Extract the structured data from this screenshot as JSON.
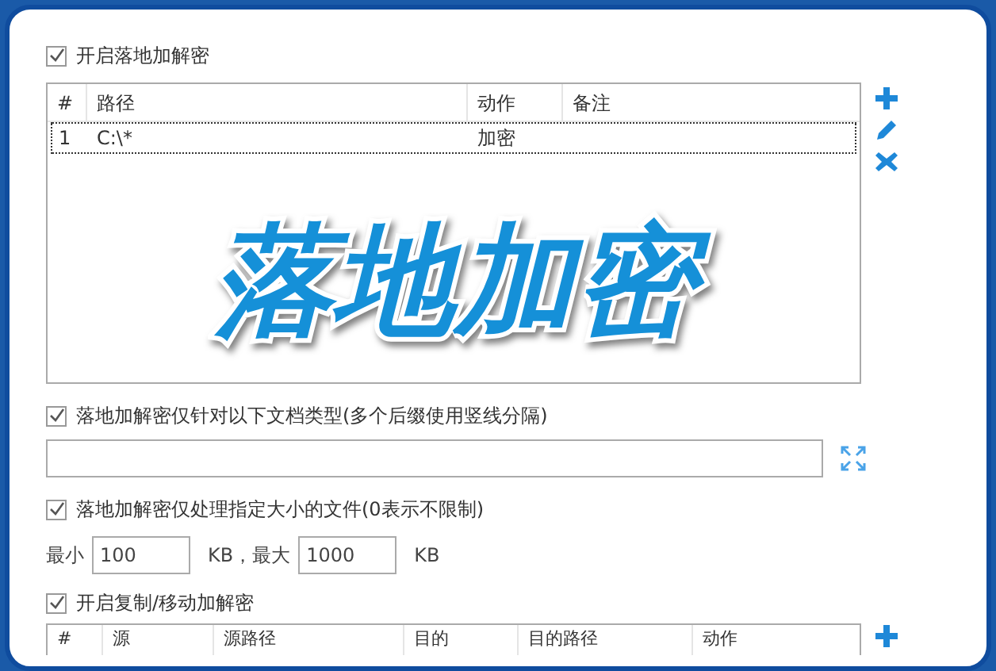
{
  "enable_section": {
    "label": "开启落地加解密",
    "checked": true
  },
  "rules_table": {
    "columns": [
      "#",
      "路径",
      "动作",
      "备注"
    ],
    "rows": [
      {
        "cells": [
          "1",
          "C:\\*",
          "加密",
          ""
        ],
        "selected": true
      }
    ]
  },
  "overlay_title": "落地加密",
  "doc_types": {
    "label": "落地加解密仅针对以下文档类型(多个后缀使用竖线分隔)",
    "checked": true
  },
  "size_limit": {
    "label": "落地加解密仅处理指定大小的文件(0表示不限制)",
    "checked": true,
    "min_label": "最小",
    "min_value": "100",
    "max_label": "KB，最大",
    "max_value": "1000",
    "unit": "KB"
  },
  "copy_move": {
    "label": "开启复制/移动加解密",
    "checked": true
  },
  "copy_table": {
    "columns": [
      "#",
      "源",
      "源路径",
      "目的",
      "目的路径",
      "动作"
    ]
  }
}
